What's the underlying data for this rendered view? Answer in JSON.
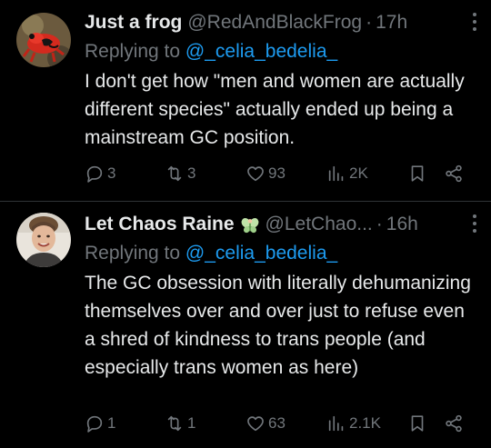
{
  "tweets": [
    {
      "display_name": "Just a frog",
      "handle": "@RedAndBlackFrog",
      "dot": "·",
      "time": "17h",
      "reply_prefix": "Replying to ",
      "reply_to": "@_celia_bedelia_",
      "text": "I don't get how \"men and women are actually different species\" actually ended up being a mainstream GC position.",
      "replies": "3",
      "retweets": "3",
      "likes": "93",
      "views": "2K",
      "avatar": "frog-avatar",
      "has_badge": false
    },
    {
      "display_name": "Let Chaos Raine",
      "handle": "@LetChao...",
      "dot": "·",
      "time": "16h",
      "reply_prefix": "Replying to ",
      "reply_to": "@_celia_bedelia_",
      "text": "The GC obsession with literally dehumanizing themselves over and over just to refuse even a shred of kindness to trans people (and especially trans women as here)",
      "replies": "1",
      "retweets": "1",
      "likes": "63",
      "views": "2.1K",
      "avatar": "person-avatar",
      "has_badge": true,
      "badge_icon": "fairy-icon"
    }
  ],
  "colors": {
    "background": "#000000",
    "text": "#e7e9ea",
    "muted": "#71767b",
    "link": "#1d9bf0",
    "divider": "#2f3336"
  }
}
